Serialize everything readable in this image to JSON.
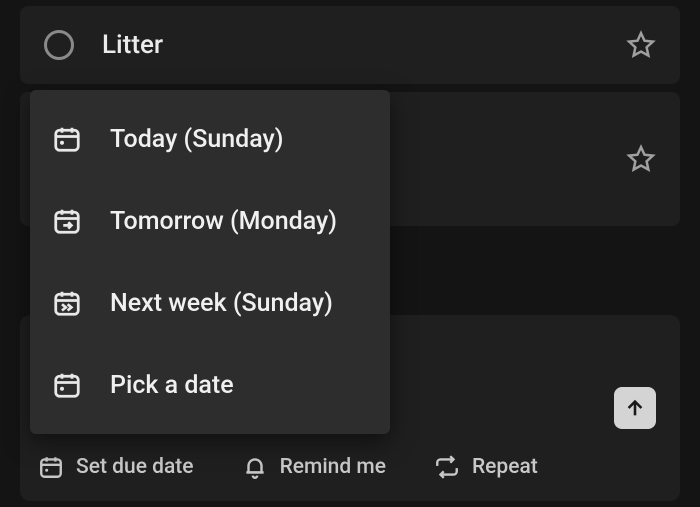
{
  "tasks": [
    {
      "title": "Litter",
      "starred": false
    },
    {
      "title": "",
      "starred": false
    }
  ],
  "due_date_menu": {
    "items": [
      {
        "icon": "calendar-today-icon",
        "label": "Today (Sunday)"
      },
      {
        "icon": "calendar-tomorrow-icon",
        "label": "Tomorrow (Monday)"
      },
      {
        "icon": "calendar-next-week-icon",
        "label": "Next week (Sunday)"
      },
      {
        "icon": "calendar-pick-icon",
        "label": "Pick a date"
      }
    ]
  },
  "toolbar": {
    "set_due_date": "Set due date",
    "remind_me": "Remind me",
    "repeat": "Repeat"
  }
}
